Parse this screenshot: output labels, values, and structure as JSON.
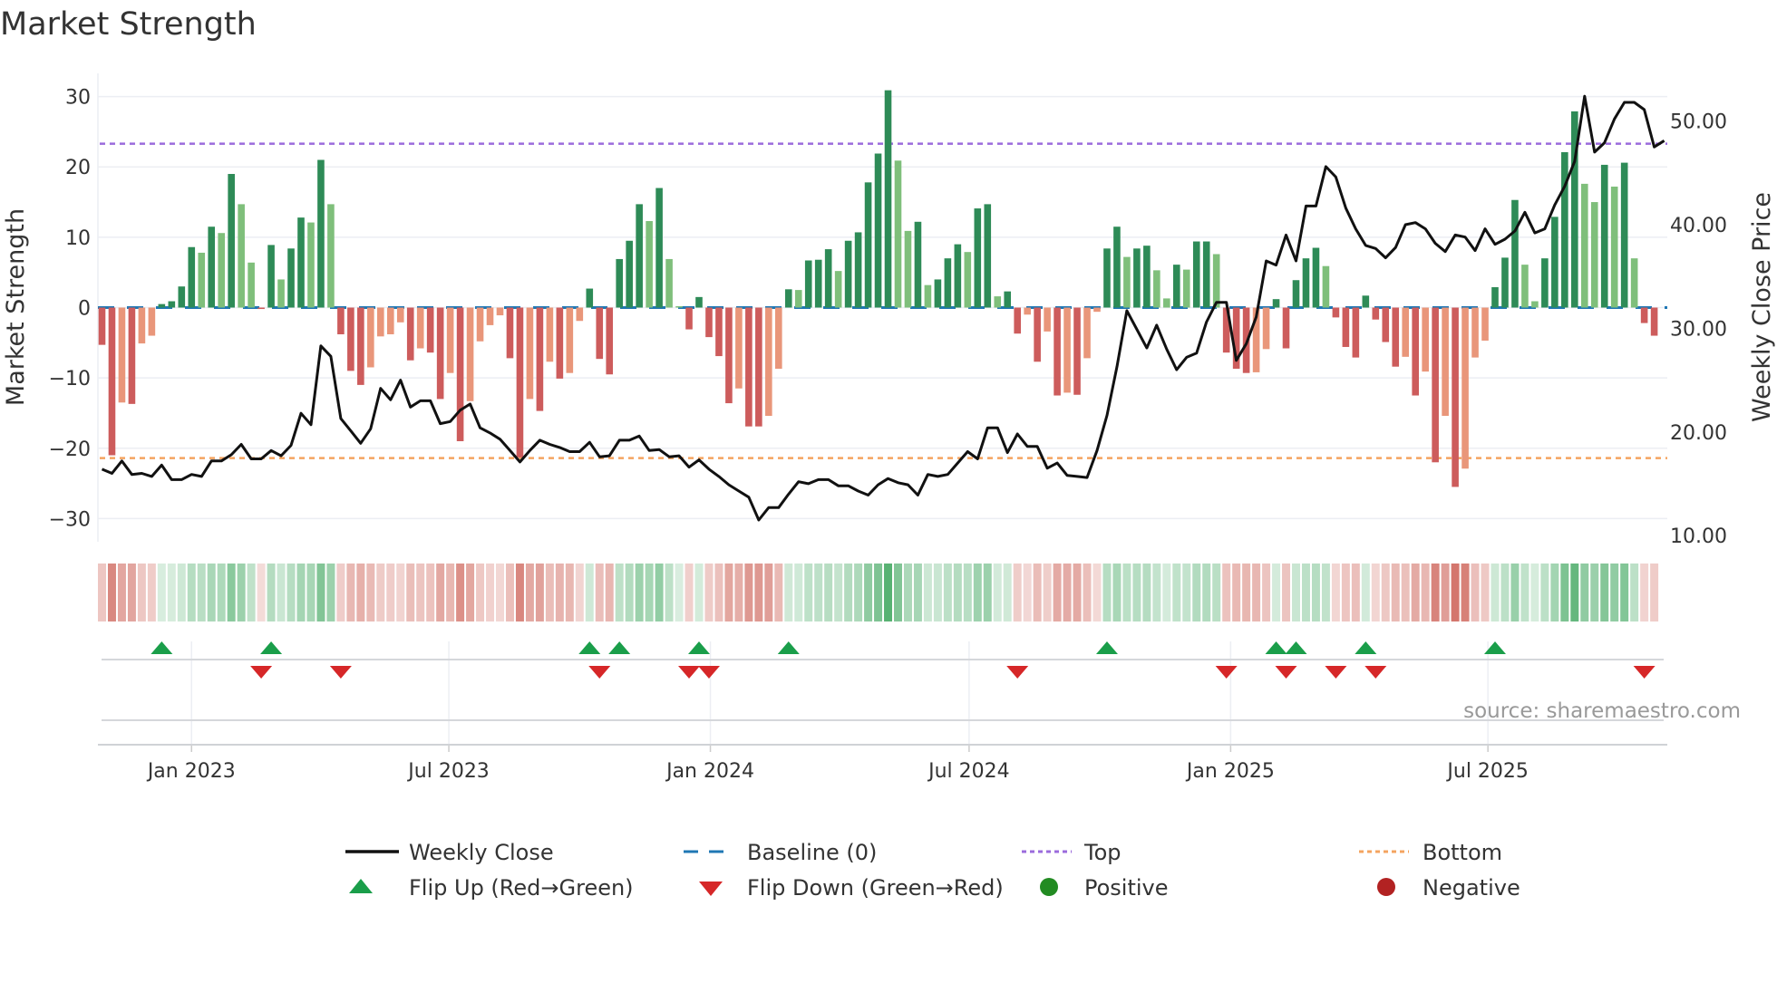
{
  "chart_data": {
    "type": "bar",
    "title": "Market Strength",
    "ylabel": "Market Strength",
    "y2label": "Weekly Close Price",
    "ylim": [
      -33.3,
      33.3
    ],
    "y2lim": [
      9.4,
      54.6
    ],
    "yticks": [
      30,
      20,
      10,
      0,
      -10,
      -20,
      -30
    ],
    "ytick_labels": [
      "30",
      "20",
      "10",
      "0",
      "−10",
      "−20",
      "−30"
    ],
    "y2ticks": [
      50,
      40,
      30,
      20,
      10
    ],
    "y2tick_labels": [
      "50.00",
      "40.00",
      "30.00",
      "20.00",
      "10.00"
    ],
    "x_start": "2022-10-30",
    "x_interval_days": 7,
    "xticks": [
      "2023-01-01",
      "2023-07-01",
      "2024-01-01",
      "2024-07-01",
      "2025-01-01",
      "2025-07-01"
    ],
    "xtick_labels": [
      "Jan 2023",
      "Jul 2023",
      "Jan 2024",
      "Jul 2024",
      "Jan 2025",
      "Jul 2025"
    ],
    "top_level": 23.3,
    "bottom_level": -21.4,
    "baseline": 0,
    "strength": [
      -5.3,
      -21,
      -13.5,
      -13.7,
      -5.1,
      -4,
      0.5,
      0.9,
      3,
      8.6,
      7.8,
      11.5,
      10.6,
      19,
      14.7,
      6.4,
      -0.2,
      8.9,
      4,
      8.4,
      12.8,
      12.1,
      21,
      14.7,
      -3.8,
      -9,
      -11,
      -8.5,
      -4.1,
      -3.8,
      -2.1,
      -7.5,
      -5.8,
      -6.4,
      -13,
      -9.3,
      -19,
      -13.3,
      -4.8,
      -2.5,
      -1.1,
      -7.2,
      -21.3,
      -13,
      -14.7,
      -7.7,
      -10.1,
      -9.3,
      -1.9,
      2.7,
      -7.3,
      -9.5,
      6.9,
      9.5,
      14.7,
      12.3,
      17,
      6.9,
      0.2,
      -3.1,
      1.5,
      -4.2,
      -6.9,
      -13.6,
      -11.5,
      -16.9,
      -16.9,
      -15.4,
      -8.7,
      2.6,
      2.5,
      6.7,
      6.8,
      8.3,
      5.2,
      9.5,
      10.7,
      17.8,
      21.9,
      30.9,
      20.9,
      10.9,
      12.2,
      3.2,
      4,
      7,
      9,
      7.9,
      14.1,
      14.7,
      1.6,
      2.3,
      -3.7,
      -1,
      -7.7,
      -3.4,
      -12.5,
      -12.1,
      -12.4,
      -7.2,
      -0.6,
      8.4,
      11.5,
      7.2,
      8.4,
      8.8,
      5.3,
      1.3,
      6.1,
      5.4,
      9.4,
      9.4,
      7.6,
      -6.4,
      -8.7,
      -9.3,
      -9.2,
      -5.9,
      1.2,
      -5.8,
      3.9,
      7,
      8.5,
      5.9,
      -1.4,
      -5.6,
      -7.1,
      1.7,
      -1.7,
      -4.9,
      -8.4,
      -7,
      -12.5,
      -9.1,
      -22,
      -15.4,
      -25.5,
      -22.9,
      -7.1,
      -4.7,
      2.9,
      7.1,
      15.3,
      6.1,
      0.9,
      7,
      12.9,
      22.1,
      27.9,
      17.6,
      15,
      20.3,
      17.2,
      20.6,
      7,
      -2.2,
      -4
    ],
    "close": [
      16.4,
      16.0,
      17.2,
      15.9,
      16.0,
      15.7,
      16.8,
      15.4,
      15.4,
      15.9,
      15.7,
      17.2,
      17.2,
      17.8,
      18.8,
      17.4,
      17.4,
      18.2,
      17.7,
      18.7,
      21.8,
      20.7,
      28.3,
      27.3,
      21.3,
      20.1,
      18.9,
      20.3,
      24.2,
      23.1,
      25.0,
      22.4,
      23.0,
      23.0,
      20.8,
      21.0,
      22.1,
      22.7,
      20.4,
      19.9,
      19.3,
      18.2,
      17.1,
      18.2,
      19.2,
      18.8,
      18.5,
      18.1,
      18.1,
      19.0,
      17.6,
      17.7,
      19.2,
      19.2,
      19.6,
      18.2,
      18.3,
      17.6,
      17.7,
      16.6,
      17.3,
      16.4,
      15.7,
      14.9,
      14.3,
      13.7,
      11.5,
      12.7,
      12.7,
      14.0,
      15.2,
      15.0,
      15.4,
      15.4,
      14.8,
      14.8,
      14.3,
      13.9,
      14.9,
      15.5,
      15.1,
      14.9,
      13.9,
      15.9,
      15.7,
      15.9,
      17.0,
      18.1,
      17.4,
      20.4,
      20.4,
      18.0,
      19.8,
      18.6,
      18.6,
      16.5,
      17.0,
      15.8,
      15.7,
      15.6,
      18.2,
      21.6,
      26.3,
      31.7,
      29.9,
      28.1,
      30.3,
      28.0,
      26.0,
      27.2,
      27.6,
      30.6,
      32.5,
      32.5,
      26.9,
      28.5,
      31.1,
      36.5,
      36.1,
      39.0,
      36.5,
      41.8,
      41.8,
      45.6,
      44.6,
      41.6,
      39.6,
      38.0,
      37.7,
      36.8,
      37.8,
      40.0,
      40.2,
      39.6,
      38.2,
      37.4,
      39.0,
      38.8,
      37.5,
      39.6,
      38.1,
      38.6,
      39.4,
      41.2,
      39.2,
      39.6,
      41.9,
      43.7,
      46.1,
      52.4,
      47.0,
      47.9,
      50.2,
      51.8,
      51.8,
      51.1,
      47.5,
      48.1
    ],
    "flip_up_weeks": [
      6,
      17,
      49,
      52,
      60,
      69,
      101,
      118,
      120,
      127,
      140
    ],
    "flip_down_weeks": [
      16,
      24,
      50,
      59,
      61,
      92,
      113,
      119,
      124,
      128,
      155
    ],
    "legend": [
      {
        "label": "Weekly Close",
        "kind": "line"
      },
      {
        "label": "Baseline (0)",
        "kind": "dash"
      },
      {
        "label": "Top",
        "kind": "dot-purple"
      },
      {
        "label": "Bottom",
        "kind": "dot-orange"
      },
      {
        "label": "Flip Up (Red→Green)",
        "kind": "tri-up"
      },
      {
        "label": "Flip Down (Green→Red)",
        "kind": "tri-down"
      },
      {
        "label": "Positive",
        "kind": "circle-green"
      },
      {
        "label": "Negative",
        "kind": "circle-red"
      }
    ],
    "legend_placement": "bottom",
    "source": "source: sharemaestro.com",
    "colors": {
      "pos_strong": "#2e8b57",
      "pos_weak": "#7fbf7b",
      "neg_strong": "#cd5c5c",
      "neg_weak": "#e9967a",
      "close": "#111111",
      "baseline": "#1f77b4",
      "top": "#9b6bdc",
      "bottom": "#f4a460",
      "flip_up": "#1a9e4a",
      "flip_down": "#d62728",
      "positive": "#228b22",
      "negative": "#b22222"
    }
  }
}
